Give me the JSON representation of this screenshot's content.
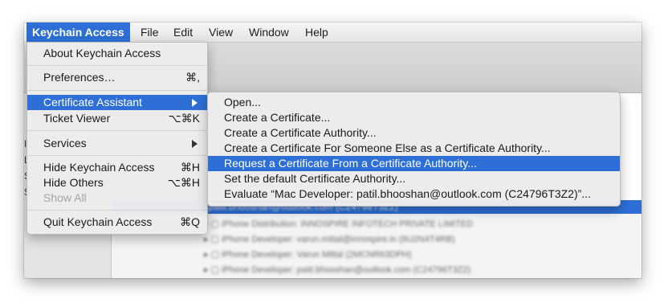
{
  "menubar": {
    "items": [
      {
        "label": "Keychain Access"
      },
      {
        "label": "File"
      },
      {
        "label": "Edit"
      },
      {
        "label": "View"
      },
      {
        "label": "Window"
      },
      {
        "label": "Help"
      }
    ]
  },
  "app_menu": {
    "about": "About Keychain Access",
    "preferences": {
      "label": "Preferences…",
      "shortcut": "⌘,"
    },
    "certificate_assistant": "Certificate Assistant",
    "ticket_viewer": {
      "label": "Ticket Viewer",
      "shortcut": "⌥⌘K"
    },
    "services": "Services",
    "hide": {
      "label": "Hide Keychain Access",
      "shortcut": "⌘H"
    },
    "hide_others": {
      "label": "Hide Others",
      "shortcut": "⌥⌘H"
    },
    "show_all": "Show All",
    "quit": {
      "label": "Quit Keychain Access",
      "shortcut": "⌘Q"
    }
  },
  "submenu": {
    "items": [
      "Open...",
      "Create a Certificate...",
      "Create a Certificate Authority...",
      "Create a Certificate For Someone Else as a Certificate Authority...",
      "Request a Certificate From a Certificate Authority...",
      "Set the default Certificate Authority...",
      "Evaluate “Mac Developer: patil.bhooshan@outlook.com (C24796T3Z2)”..."
    ]
  },
  "background": {
    "left_fragments": [
      "I",
      "L",
      "S",
      "S"
    ],
    "selected_row": "r: patil.bhooshan@outlook.com (C24796T3Z2)"
  },
  "colors": {
    "highlight": "#2d6fd6"
  }
}
